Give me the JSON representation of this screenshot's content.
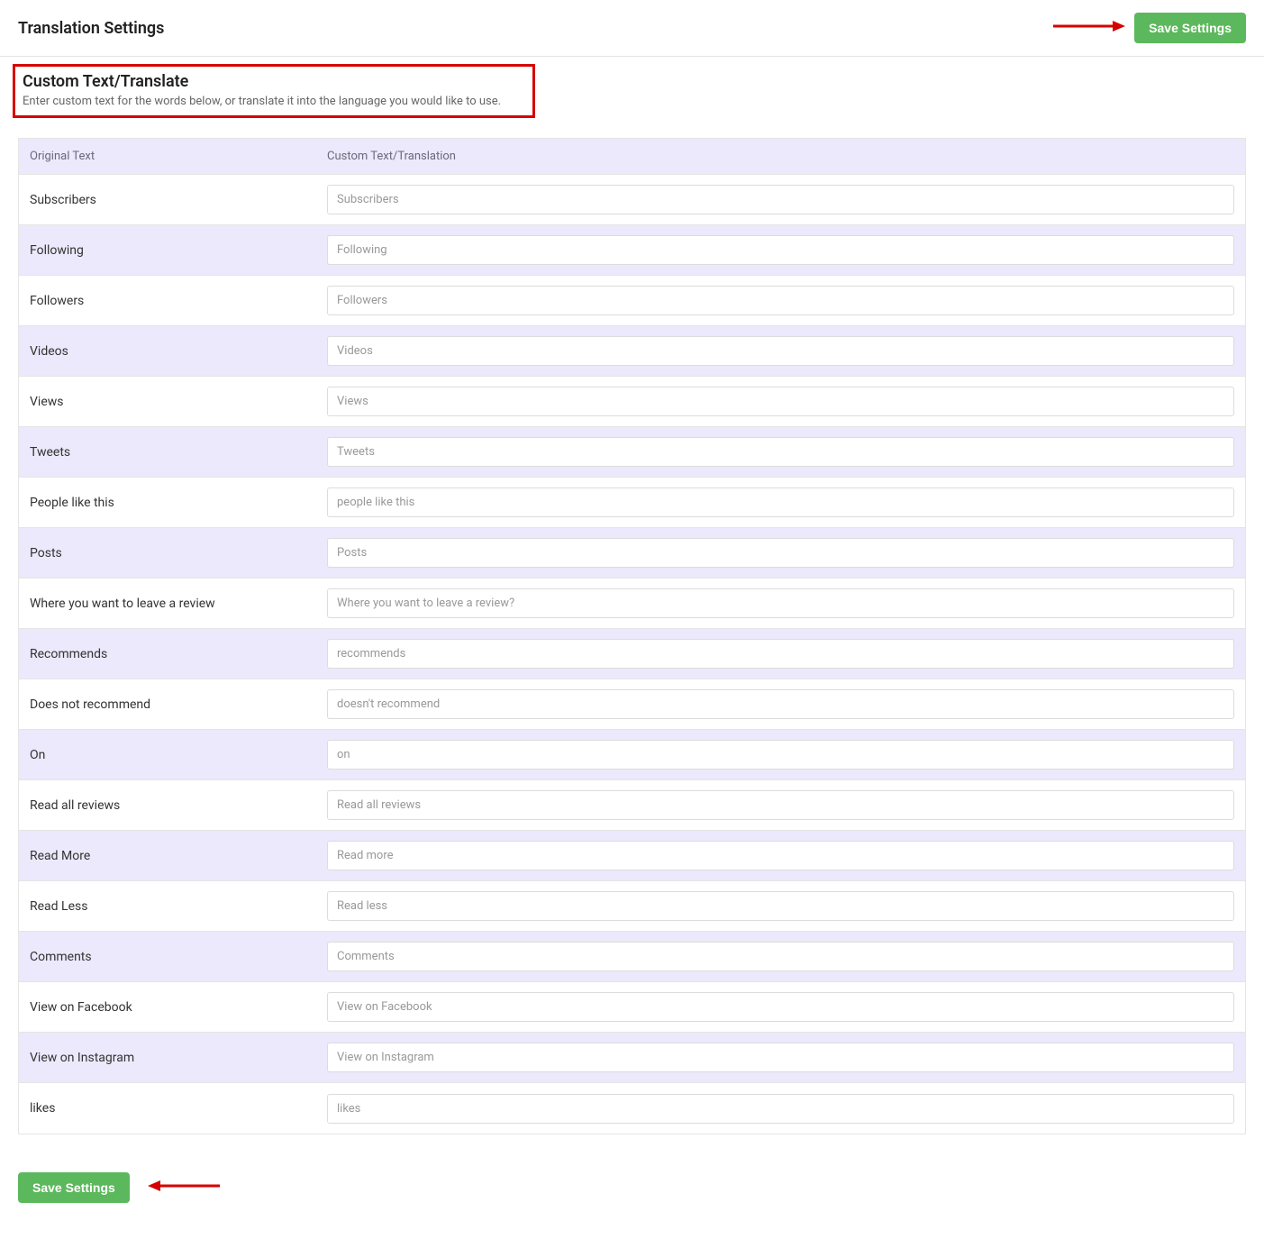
{
  "header": {
    "title": "Translation Settings",
    "save_label": "Save Settings"
  },
  "section": {
    "title": "Custom Text/Translate",
    "description": "Enter custom text for the words below, or translate it into the language you would like to use."
  },
  "table": {
    "col_original": "Original Text",
    "col_custom": "Custom Text/Translation",
    "rows": [
      {
        "original": "Subscribers",
        "placeholder": "Subscribers"
      },
      {
        "original": "Following",
        "placeholder": "Following"
      },
      {
        "original": "Followers",
        "placeholder": "Followers"
      },
      {
        "original": "Videos",
        "placeholder": "Videos"
      },
      {
        "original": "Views",
        "placeholder": "Views"
      },
      {
        "original": "Tweets",
        "placeholder": "Tweets"
      },
      {
        "original": "People like this",
        "placeholder": "people like this"
      },
      {
        "original": "Posts",
        "placeholder": "Posts"
      },
      {
        "original": "Where you want to leave a review",
        "placeholder": "Where you want to leave a review?"
      },
      {
        "original": "Recommends",
        "placeholder": "recommends"
      },
      {
        "original": "Does not recommend",
        "placeholder": "doesn't recommend"
      },
      {
        "original": "On",
        "placeholder": "on"
      },
      {
        "original": "Read all reviews",
        "placeholder": "Read all reviews"
      },
      {
        "original": "Read More",
        "placeholder": "Read more"
      },
      {
        "original": "Read Less",
        "placeholder": "Read less"
      },
      {
        "original": "Comments",
        "placeholder": "Comments"
      },
      {
        "original": "View on Facebook",
        "placeholder": "View on Facebook"
      },
      {
        "original": "View on Instagram",
        "placeholder": "View on Instagram"
      },
      {
        "original": "likes",
        "placeholder": "likes"
      }
    ]
  },
  "footer": {
    "save_label": "Save Settings"
  }
}
